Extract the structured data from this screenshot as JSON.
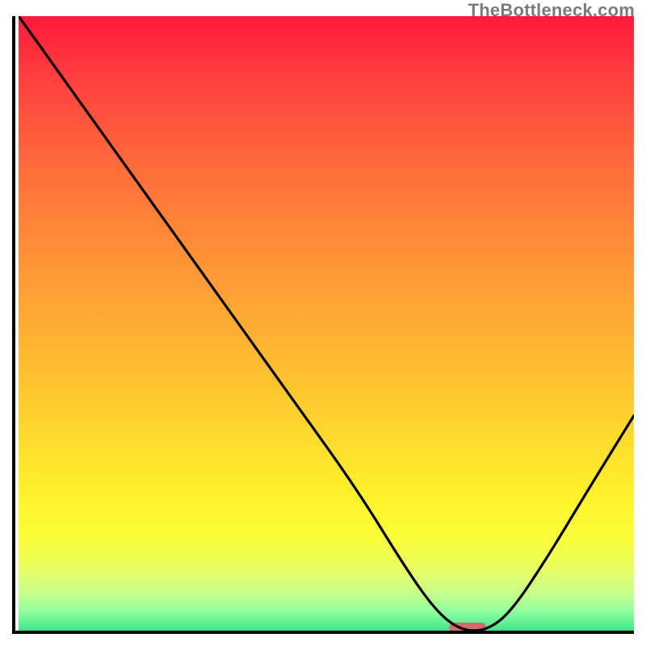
{
  "watermark": "TheBottleneck.com",
  "chart_data": {
    "type": "line",
    "title": "",
    "xlabel": "",
    "ylabel": "",
    "xlim": [
      0,
      100
    ],
    "ylim": [
      0,
      100
    ],
    "grid": false,
    "background_gradient": {
      "direction": "vertical",
      "top_color": "#ff1a3b",
      "bottom_color": "#41e38c",
      "description": "red→orange→yellow→green"
    },
    "series": [
      {
        "name": "bottleneck-curve",
        "color": "#000000",
        "x": [
          0,
          5,
          15,
          25,
          35,
          45,
          55,
          63,
          68,
          72,
          76,
          80,
          86,
          92,
          100
        ],
        "values": [
          100,
          93,
          79,
          65,
          51,
          37,
          23,
          10,
          3,
          0,
          0,
          3,
          12,
          22,
          35
        ]
      }
    ],
    "annotations": [
      {
        "name": "optimal-marker",
        "type": "bar",
        "x_center": 73,
        "width": 6,
        "color": "#d46a6a"
      }
    ]
  }
}
